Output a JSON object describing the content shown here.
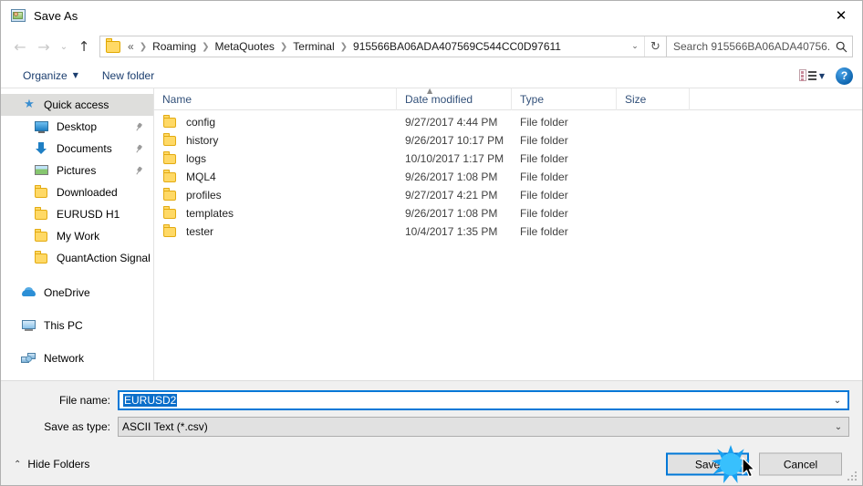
{
  "window": {
    "title": "Save As",
    "icon": "save-as-app-icon",
    "close_label": "✕"
  },
  "address_bar": {
    "back_icon": "←",
    "forward_icon": "→",
    "recent_icon": "⌄",
    "up_icon": "↑",
    "folder_icon": "folder-icon",
    "lead_separator": "«",
    "crumbs": [
      "Roaming",
      "MetaQuotes",
      "Terminal",
      "915566BA06ADA407569C544CC0D97611"
    ],
    "crumb_separator": "❯",
    "dropdown_icon": "⌄",
    "refresh_icon": "↻",
    "search_placeholder": "Search 915566BA06ADA40756...",
    "search_icon": "search-icon"
  },
  "toolbar": {
    "organize_label": "Organize",
    "organize_caret": "▼",
    "new_folder_label": "New folder",
    "view_icon": "view-layout-icon",
    "view_caret": "▼",
    "help_label": "?"
  },
  "sidebar": {
    "items": [
      {
        "label": "Quick access",
        "icon": "star-icon",
        "selected": true,
        "pinned": false,
        "indent": false
      },
      {
        "label": "Desktop",
        "icon": "desktop-icon",
        "selected": false,
        "pinned": true,
        "indent": true
      },
      {
        "label": "Documents",
        "icon": "documents-icon",
        "selected": false,
        "pinned": true,
        "indent": true
      },
      {
        "label": "Pictures",
        "icon": "pictures-icon",
        "selected": false,
        "pinned": true,
        "indent": true
      },
      {
        "label": "Downloaded",
        "icon": "folder-icon",
        "selected": false,
        "pinned": false,
        "indent": true
      },
      {
        "label": "EURUSD H1",
        "icon": "folder-icon",
        "selected": false,
        "pinned": false,
        "indent": true
      },
      {
        "label": "My Work",
        "icon": "folder-icon",
        "selected": false,
        "pinned": false,
        "indent": true
      },
      {
        "label": "QuantAction Signal",
        "icon": "folder-icon",
        "selected": false,
        "pinned": false,
        "indent": true
      },
      {
        "label": "OneDrive",
        "icon": "onedrive-icon",
        "selected": false,
        "pinned": false,
        "indent": false,
        "spacer_before": true
      },
      {
        "label": "This PC",
        "icon": "this-pc-icon",
        "selected": false,
        "pinned": false,
        "indent": false,
        "spacer_before": true
      },
      {
        "label": "Network",
        "icon": "network-icon",
        "selected": false,
        "pinned": false,
        "indent": false,
        "spacer_before": true
      }
    ]
  },
  "file_list": {
    "columns": [
      "Name",
      "Date modified",
      "Type",
      "Size"
    ],
    "sort_column": "Name",
    "sort_direction": "ascending",
    "sort_icon": "▲",
    "rows": [
      {
        "name": "config",
        "date": "9/27/2017 4:44 PM",
        "type": "File folder",
        "size": "",
        "icon": "folder-icon"
      },
      {
        "name": "history",
        "date": "9/26/2017 10:17 PM",
        "type": "File folder",
        "size": "",
        "icon": "folder-icon"
      },
      {
        "name": "logs",
        "date": "10/10/2017 1:17 PM",
        "type": "File folder",
        "size": "",
        "icon": "folder-icon"
      },
      {
        "name": "MQL4",
        "date": "9/26/2017 1:08 PM",
        "type": "File folder",
        "size": "",
        "icon": "folder-icon"
      },
      {
        "name": "profiles",
        "date": "9/27/2017 4:21 PM",
        "type": "File folder",
        "size": "",
        "icon": "folder-icon"
      },
      {
        "name": "templates",
        "date": "9/26/2017 1:08 PM",
        "type": "File folder",
        "size": "",
        "icon": "folder-icon"
      },
      {
        "name": "tester",
        "date": "10/4/2017 1:35 PM",
        "type": "File folder",
        "size": "",
        "icon": "folder-icon"
      }
    ]
  },
  "form": {
    "file_name_label": "File name:",
    "file_name_value": "EURUSD2",
    "file_name_selected": true,
    "save_type_label": "Save as type:",
    "save_type_value": "ASCII Text (*.csv)",
    "dropdown_icon": "⌄"
  },
  "footer": {
    "hide_folders_label": "Hide Folders",
    "hide_folders_caret": "⌃",
    "save_label": "Save",
    "cancel_label": "Cancel",
    "default_button": "Save"
  },
  "pointer": {
    "click_effect": "click-burst",
    "cursor": "arrow-cursor"
  },
  "colors": {
    "accent": "#0078d7",
    "selection": "#0b6ec9",
    "folder": "#ffd966",
    "sidebar_selected": "#dededc",
    "click_burst": "#18a0f0"
  }
}
